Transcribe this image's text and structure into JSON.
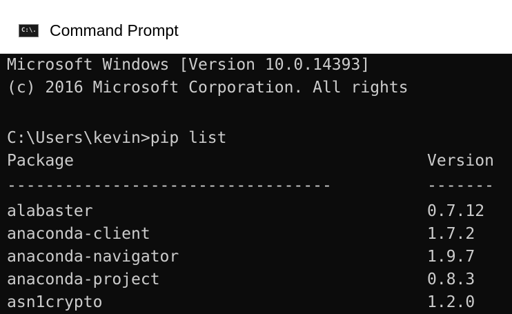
{
  "window": {
    "title": "Command Prompt",
    "icon_text": "C:\\.",
    "icon": "console-icon"
  },
  "console": {
    "header_lines": [
      "Microsoft Windows [Version 10.0.14393]",
      "(c) 2016 Microsoft Corporation. All rights"
    ],
    "prompt_line": "C:\\Users\\kevin>pip list",
    "table_header": {
      "package": "Package",
      "version": "Version"
    },
    "separator": {
      "package": "----------------------------------",
      "version": "-------"
    },
    "packages": [
      {
        "name": "alabaster",
        "version": "0.7.12"
      },
      {
        "name": "anaconda-client",
        "version": "1.7.2"
      },
      {
        "name": "anaconda-navigator",
        "version": "1.9.7"
      },
      {
        "name": "anaconda-project",
        "version": "0.8.3"
      },
      {
        "name": "asn1crypto",
        "version": "1.2.0"
      }
    ]
  },
  "colors": {
    "background": "#0c0c0c",
    "text": "#cccccc",
    "titlebar": "#ffffff"
  }
}
